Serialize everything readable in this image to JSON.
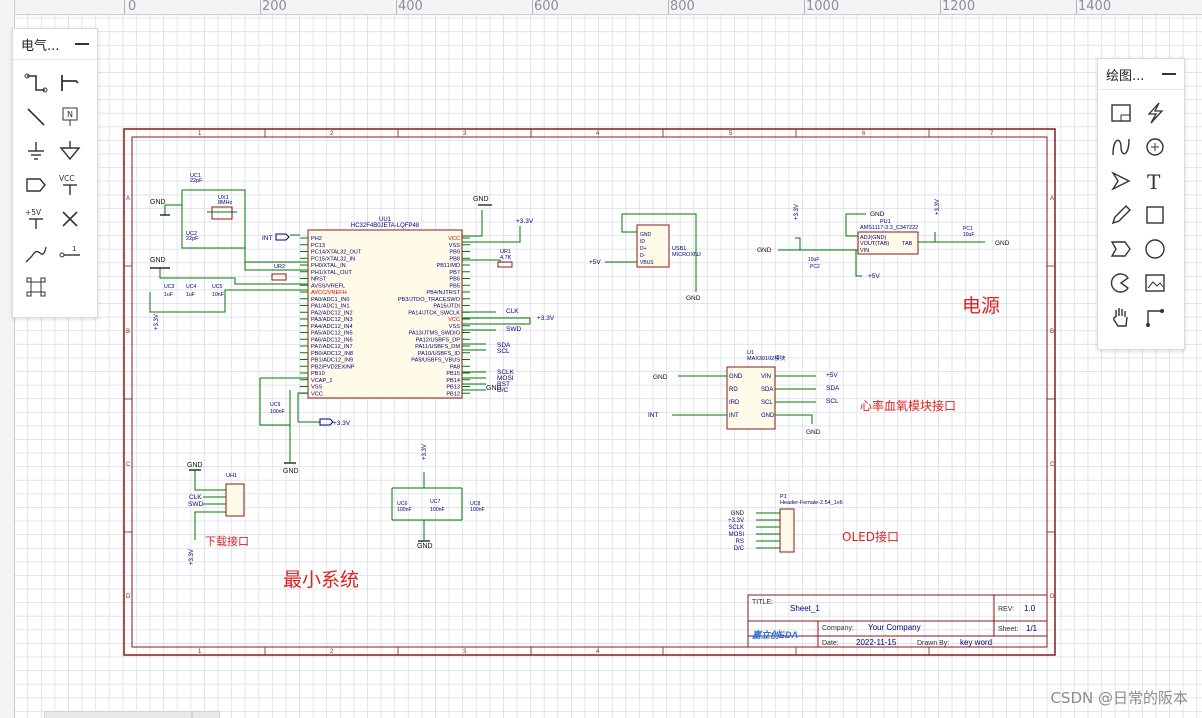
{
  "ruler": {
    "labels": [
      "0",
      "200",
      "400",
      "600",
      "800",
      "1000",
      "1200",
      "1400"
    ]
  },
  "electrical_panel": {
    "title": "电气...",
    "tools": [
      {
        "icon": "wire-icon"
      },
      {
        "icon": "bus-icon"
      },
      {
        "icon": "line-icon"
      },
      {
        "icon": "net-label-icon",
        "glyph": "N"
      },
      {
        "icon": "ground-icon"
      },
      {
        "icon": "signal-ground-icon"
      },
      {
        "icon": "net-port-icon"
      },
      {
        "icon": "vcc-icon",
        "glyph": "VCC"
      },
      {
        "icon": "plus5v-icon",
        "glyph": "+5V"
      },
      {
        "icon": "no-connect-icon"
      },
      {
        "icon": "probe-icon"
      },
      {
        "icon": "pin-icon",
        "glyph": "1"
      },
      {
        "icon": "group-icon"
      }
    ]
  },
  "drawing_panel": {
    "title": "绘图...",
    "tools": [
      {
        "icon": "schematic-frame-icon"
      },
      {
        "icon": "lightning-icon"
      },
      {
        "icon": "bezier-icon"
      },
      {
        "icon": "circle-plus-icon"
      },
      {
        "icon": "arrow-head-icon"
      },
      {
        "icon": "text-icon",
        "glyph": "T"
      },
      {
        "icon": "pencil-icon"
      },
      {
        "icon": "rectangle-icon"
      },
      {
        "icon": "polygon-icon"
      },
      {
        "icon": "circle-icon"
      },
      {
        "icon": "pie-icon"
      },
      {
        "icon": "image-icon"
      },
      {
        "icon": "pan-hand-icon"
      },
      {
        "icon": "dimension-icon"
      }
    ]
  },
  "schematic": {
    "labels": {
      "minimal_system": "最小系统",
      "power": "电源",
      "hr_module": "心率血氧模块接口",
      "oled": "OLED接口",
      "download": "下载接口"
    },
    "mcu": {
      "ref": "UU1",
      "part": "HC32F4B0JETA-LQFP48",
      "left_pins": [
        "PH2",
        "PC13",
        "PC14/XTAL32_OUT",
        "PC15/XTAL32_IN",
        "PH0/XTAL_IN",
        "PH1/XTAL_OUT",
        "NRST",
        "AVSS/VREFL",
        "AVCC/VREFH",
        "PA0/ADC1_IN0",
        "PA1/ADC1_IN1",
        "PA2/ADC12_IN2",
        "PA3/ADC12_IN3",
        "PA4/ADC12_IN4",
        "PA5/ADC12_IN5",
        "PA6/ADC12_IN6",
        "PA7/ADC12_IN7",
        "PB0/ADC12_IN8",
        "PB1/ADC12_IN9",
        "PB2/PVD2EXINP",
        "PB10",
        "VCAP_1",
        "VSS",
        "VCC"
      ],
      "right_pins": [
        "VCC",
        "VSS",
        "PB9",
        "PB8",
        "PB11/MD",
        "PB7",
        "PB6",
        "PB5",
        "PB4/NJTRST",
        "PB3/JTDO_TRACESWO",
        "PA15/JTDI",
        "PA14/JTCK_SWCLK",
        "VCC",
        "VSS",
        "PA13/JTMS_SWDIO",
        "PA12/USBFS_DP",
        "PA11/USBFS_DM",
        "PA10/USBFS_ID",
        "PA9/USBFS_VBUS",
        "PA8",
        "PB15",
        "PB14",
        "PB13",
        "PB12"
      ]
    },
    "nets": {
      "gnd": "GND",
      "v33": "+3.3V",
      "v5": "+5V",
      "int": "INT",
      "clk": "CLK",
      "swd": "SWD",
      "sda": "SDA",
      "scl": "SCL",
      "sclk": "SCLK",
      "mosi": "MOSI",
      "rst": "RST",
      "dc": "D/C",
      "rs": "RS"
    },
    "components": {
      "uc1": [
        "UC1",
        "22pF"
      ],
      "ux1": [
        "UX1",
        "8MHz"
      ],
      "uc2": [
        "UC2",
        "22pF"
      ],
      "ur2": "UR2",
      "uc3": [
        "UC3",
        "1uF"
      ],
      "uc4": [
        "UC4",
        "1uF"
      ],
      "uc5": [
        "UC5",
        "10nF"
      ],
      "ur1": [
        "UR1",
        "4.7K"
      ],
      "uc9": [
        "UC9",
        "100nF"
      ],
      "uh1": "UH1",
      "uc6": [
        "UC6",
        "100nF"
      ],
      "uc7": [
        "UC7",
        "100nF"
      ],
      "uc8": [
        "UC8",
        "100nF"
      ],
      "usb1": [
        "USB1",
        "MICROXNJ"
      ],
      "ldo": [
        "PU1",
        "AMS1117-3.3_C347222"
      ],
      "ldo_pins": [
        "ADJ(GND)",
        "VOUT(TAB)",
        "VIN",
        "TAB"
      ],
      "pc1": [
        "PC1",
        "10uF"
      ],
      "pc2": [
        "PC2",
        "10uF"
      ],
      "max": [
        "U1",
        "MAX30102模块"
      ],
      "max_left": [
        "GND",
        "RD",
        "IRD",
        "INT"
      ],
      "max_right": [
        "VIN",
        "SDA",
        "SCL",
        "GND"
      ],
      "oled": [
        "P1",
        "Header-Female-2.54_1x6"
      ],
      "usb_pins": [
        "GND",
        "ID",
        "D+",
        "D-",
        "VBUS"
      ]
    },
    "grid_markers": {
      "cols": [
        "1",
        "2",
        "3",
        "4",
        "5",
        "6",
        "7"
      ],
      "rows": [
        "A",
        "B",
        "C",
        "D"
      ]
    },
    "title_block": {
      "title_label": "TITLE:",
      "title": "Sheet_1",
      "rev_label": "REV:",
      "rev": "1.0",
      "company_label": "Company:",
      "company": "Your Company",
      "sheet_label": "Sheet:",
      "sheet": "1/1",
      "date_label": "Date:",
      "date": "2022-11-15",
      "drawn_label": "Drawn By:",
      "drawn": "key word",
      "logo": "嘉立创EDA"
    }
  },
  "watermark": "CSDN @日常的阪本",
  "colors": {
    "frame": "#8b1a1a",
    "wire": "#007a00",
    "part": "#8b1a1a",
    "net": "#00007f",
    "label_red": "#e02020"
  }
}
